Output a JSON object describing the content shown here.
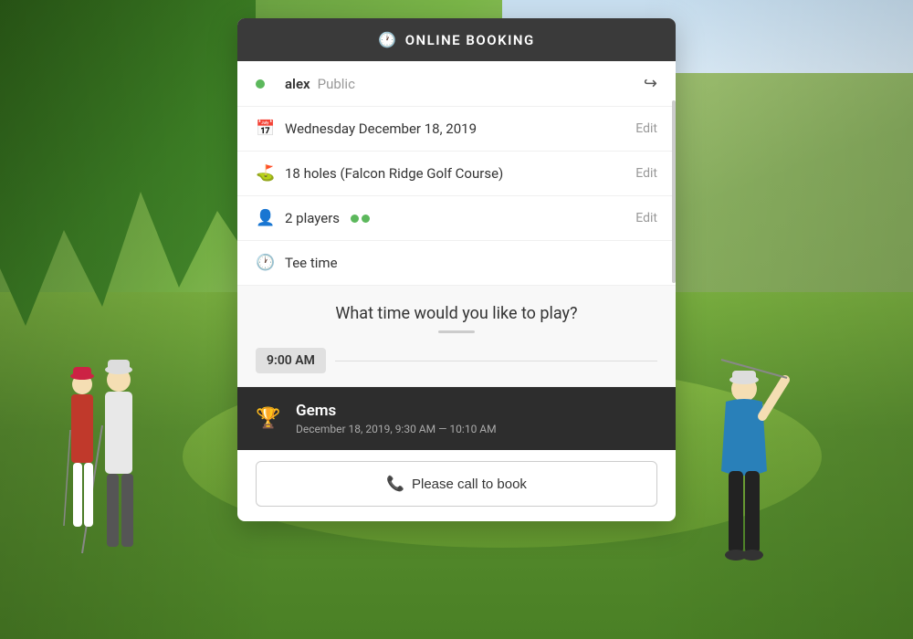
{
  "background": {
    "alt": "Golf course background"
  },
  "header": {
    "icon": "🕐",
    "title": "ONLINE BOOKING"
  },
  "user_row": {
    "username": "alex",
    "user_type": "Public",
    "export_icon": "↪"
  },
  "date_row": {
    "icon": "📅",
    "value": "Wednesday December 18, 2019",
    "edit_label": "Edit"
  },
  "holes_row": {
    "icon": "⛳",
    "value": "18 holes (Falcon Ridge Golf Course)",
    "edit_label": "Edit"
  },
  "players_row": {
    "icon": "👤",
    "value": "2 players",
    "edit_label": "Edit",
    "dot_count": 2
  },
  "tee_time_row": {
    "icon": "🕐",
    "label": "Tee time"
  },
  "tee_time_section": {
    "question": "What time would you like to play?",
    "time_slot": "9:00 AM"
  },
  "booking_card": {
    "icon": "🏆",
    "title": "Gems",
    "subtitle": "December 18, 2019, 9:30 AM — 10:10 AM"
  },
  "cta_button": {
    "icon": "📞",
    "label": "Please call to book"
  }
}
